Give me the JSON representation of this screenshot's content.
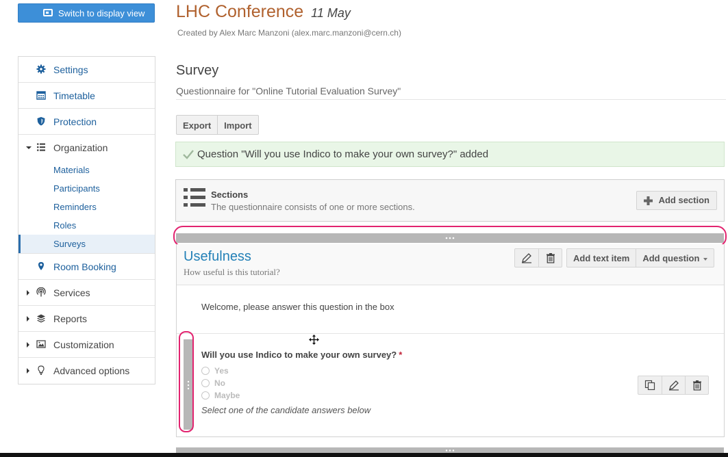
{
  "header": {
    "switch_button": "Switch to display view",
    "conference_title": "LHC Conference",
    "conference_date": "11 May",
    "created_by": "Created by Alex Marc Manzoni (alex.marc.manzoni@cern.ch)"
  },
  "sidebar": {
    "items": [
      {
        "label": "Settings",
        "icon": "gear-icon"
      },
      {
        "label": "Timetable",
        "icon": "calendar-icon"
      },
      {
        "label": "Protection",
        "icon": "shield-icon"
      },
      {
        "label": "Organization",
        "icon": "list-icon",
        "expanded": true
      },
      {
        "label": "Room Booking",
        "icon": "location-pin-icon"
      },
      {
        "label": "Services",
        "icon": "broadcast-icon"
      },
      {
        "label": "Reports",
        "icon": "layers-icon"
      },
      {
        "label": "Customization",
        "icon": "image-icon"
      },
      {
        "label": "Advanced options",
        "icon": "lightbulb-icon"
      }
    ],
    "organization_sub": [
      "Materials",
      "Participants",
      "Reminders",
      "Roles",
      "Surveys"
    ],
    "active_sub": "Surveys"
  },
  "main": {
    "title": "Survey",
    "subtitle": "Questionnaire for \"Online Tutorial Evaluation Survey\"",
    "export_label": "Export",
    "import_label": "Import",
    "alert_text": "Question \"Will you use Indico to make your own survey?\" added",
    "sections_title": "Sections",
    "sections_desc": "The questionnaire consists of one or more sections.",
    "add_section_label": "Add section",
    "section": {
      "title": "Usefulness",
      "description": "How useful is this tutorial?",
      "add_text_item": "Add text item",
      "add_question": "Add question",
      "welcome_text": "Welcome, please answer this question in the box",
      "question": {
        "title": "Will you use Indico to make your own survey?",
        "required_mark": "*",
        "options": [
          "Yes",
          "No",
          "Maybe"
        ],
        "help": "Select one of the candidate answers below"
      }
    }
  },
  "colors": {
    "accent_blue": "#3d8fd8",
    "title_orange": "#b0612e",
    "link_blue": "#1c5f9c",
    "success_bg": "#e9f6e7",
    "highlight_pink": "#e2236f"
  }
}
